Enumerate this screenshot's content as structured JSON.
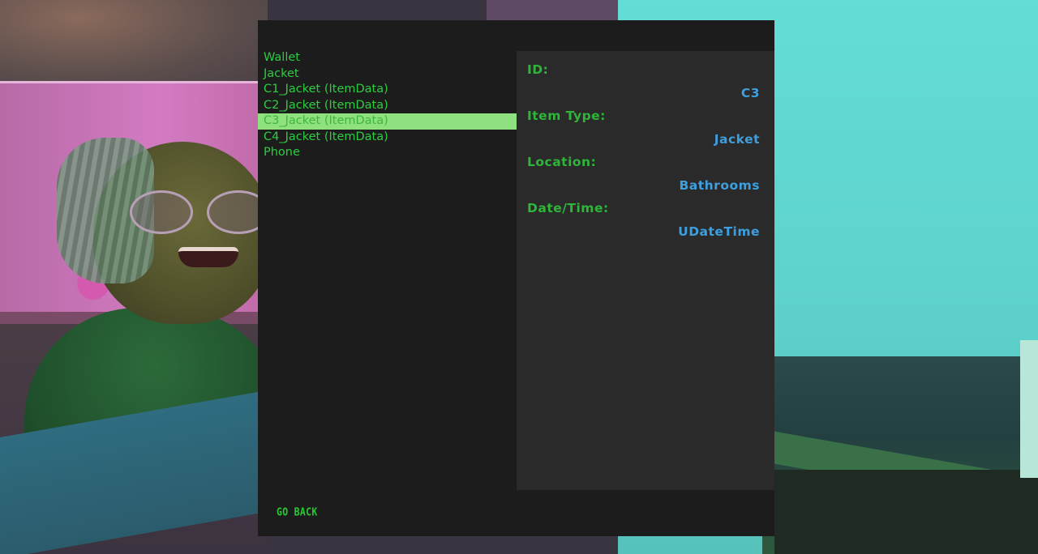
{
  "inventory": {
    "items": [
      {
        "label": "Wallet"
      },
      {
        "label": "Jacket"
      },
      {
        "label": "C1_Jacket (ItemData)"
      },
      {
        "label": "C2_Jacket (ItemData)"
      },
      {
        "label": "C3_Jacket (ItemData)",
        "selected": true
      },
      {
        "label": "C4_Jacket (ItemData)"
      },
      {
        "label": "Phone"
      }
    ]
  },
  "details": {
    "id_label": "ID:",
    "id_value": "C3",
    "item_type_label": "Item Type:",
    "item_type_value": "Jacket",
    "location_label": "Location:",
    "location_value": "Bathrooms",
    "datetime_label": "Date/Time:",
    "datetime_value": "UDateTime"
  },
  "actions": {
    "go_back_label": "GO BACK"
  },
  "colors": {
    "panel_bg": "#1c1c1c",
    "detail_bg": "#2a2a2a",
    "list_text": "#2ecc40",
    "selected_bg": "#8fe07f",
    "label_text": "#2eb53a",
    "value_text": "#3d9fe0"
  }
}
